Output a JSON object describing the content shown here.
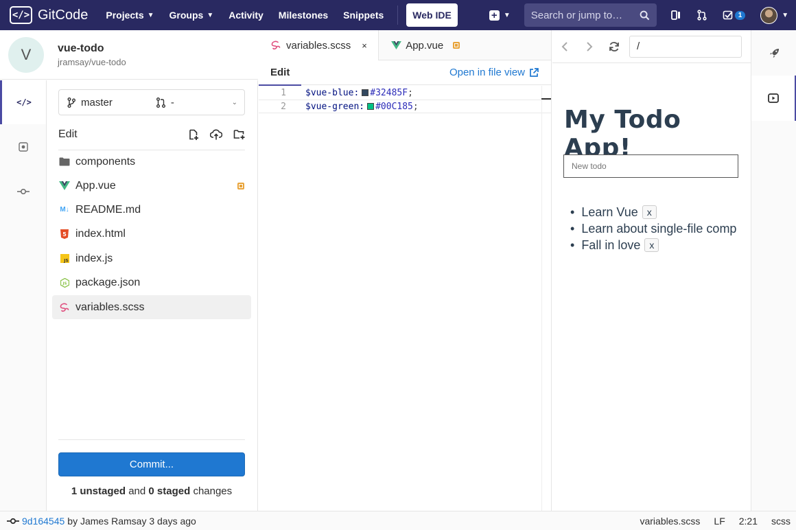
{
  "topnav": {
    "brand": "GitCode",
    "projects": "Projects",
    "groups": "Groups",
    "activity": "Activity",
    "milestones": "Milestones",
    "snippets": "Snippets",
    "web_ide": "Web IDE",
    "search_placeholder": "Search or jump to…",
    "todo_count": "1"
  },
  "project": {
    "avatar_letter": "V",
    "name": "vue-todo",
    "path": "jramsay/vue-todo"
  },
  "tree": {
    "branch": "master",
    "merge_request": "-",
    "header": "Edit",
    "files": [
      {
        "name": "components",
        "icon": "folder-icon"
      },
      {
        "name": "App.vue",
        "icon": "vue-icon",
        "modified": true
      },
      {
        "name": "README.md",
        "icon": "markdown-icon"
      },
      {
        "name": "index.html",
        "icon": "html-icon"
      },
      {
        "name": "index.js",
        "icon": "js-icon"
      },
      {
        "name": "package.json",
        "icon": "nodejs-icon"
      },
      {
        "name": "variables.scss",
        "icon": "sass-icon",
        "active": true
      }
    ],
    "commit_label": "Commit...",
    "changes": {
      "unstaged_count_text": "1 unstaged",
      "and_text": "and",
      "staged_count_text": "0 staged",
      "suffix": "changes"
    }
  },
  "editor": {
    "tabs": [
      {
        "label": "variables.scss",
        "active": true,
        "close": "×"
      },
      {
        "label": "App.vue",
        "modified": true
      }
    ],
    "subtab": "Edit",
    "open_file_view": "Open in file view",
    "lines": [
      {
        "num": "1",
        "var": "$vue-blue:",
        "color": "#32485F",
        "hex": "#32485F",
        "end": ";"
      },
      {
        "num": "2",
        "var": "$vue-green:",
        "color": "#00C185",
        "hex": "#00C185",
        "end": ";"
      }
    ]
  },
  "preview": {
    "url": "/",
    "title": "My Todo App!",
    "input_placeholder": "New todo",
    "todos": [
      {
        "text": "Learn Vue",
        "remove": "x"
      },
      {
        "text": "Learn about single-file comp"
      },
      {
        "text": "Fall in love",
        "remove": "x"
      }
    ]
  },
  "status": {
    "sha": "9d164545",
    "meta": "by James Ramsay 3 days ago",
    "file": "variables.scss",
    "eol": "LF",
    "position": "2:21",
    "language": "scss"
  },
  "colors": {
    "nav_bg": "#292961",
    "accent": "#4b4ba3",
    "link": "#1f78d1",
    "modified": "#e9a43a",
    "vue_title": "#2c3e50"
  }
}
